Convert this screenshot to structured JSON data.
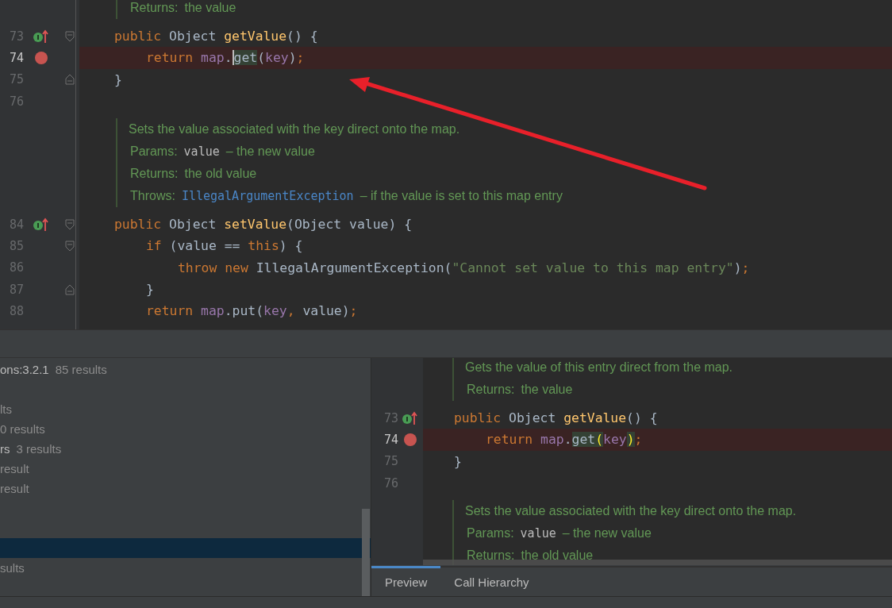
{
  "editor": {
    "rows": [
      {
        "kind": "doc",
        "lines": [
          [
            {
              "kind": "tag",
              "t": "Returns:"
            },
            {
              "kind": "text",
              "t": "the value"
            }
          ]
        ]
      },
      {
        "kind": "code",
        "number": "73",
        "override": true,
        "breakpoint": false,
        "fold_start": true,
        "fold_end": false,
        "current": false,
        "highlight": false,
        "tokens": [
          {
            "kind": "kw",
            "t": "public "
          },
          {
            "kind": "type",
            "t": "Object "
          },
          {
            "kind": "method",
            "t": "getValue"
          },
          {
            "kind": "punct",
            "t": "() {"
          }
        ],
        "children": [
          {
            "kind": "code",
            "number": "74",
            "override": false,
            "breakpoint": true,
            "fold_start": false,
            "fold_end": false,
            "current": true,
            "highlight": true,
            "tokens": [
              {
                "kind": "kw",
                "t": "return "
              },
              {
                "kind": "field",
                "t": "map"
              },
              {
                "kind": "punct",
                "t": "."
              },
              {
                "kind": "plain",
                "t": "get",
                "usage": true,
                "caret": true
              },
              {
                "kind": "punct",
                "t": "("
              },
              {
                "kind": "field",
                "t": "key"
              },
              {
                "kind": "punct",
                "t": ")"
              },
              {
                "kind": "semi",
                "t": ";"
              }
            ]
          }
        ]
      },
      {
        "kind": "code",
        "number": "75",
        "override": false,
        "breakpoint": false,
        "fold_start": false,
        "fold_end": true,
        "current": false,
        "highlight": false,
        "tokens": [
          {
            "kind": "punct",
            "t": "}"
          }
        ]
      },
      {
        "kind": "code",
        "number": "76",
        "override": false,
        "breakpoint": false,
        "fold_start": false,
        "fold_end": false,
        "current": false,
        "highlight": false,
        "tokens": []
      },
      {
        "kind": "doc",
        "lines": [
          [
            {
              "kind": "text",
              "t": "Sets the value associated with the key direct onto the map."
            }
          ],
          [
            {
              "kind": "tag",
              "t": "Params:"
            },
            {
              "kind": "code",
              "t": "value"
            },
            {
              "kind": "text",
              "t": "– the new value"
            }
          ],
          [
            {
              "kind": "tag",
              "t": "Returns:"
            },
            {
              "kind": "text",
              "t": "the old value"
            }
          ],
          [
            {
              "kind": "tag",
              "t": "Throws:"
            },
            {
              "kind": "link",
              "t": "IllegalArgumentException"
            },
            {
              "kind": "text",
              "t": "– if the value is set to this map entry"
            }
          ]
        ]
      },
      {
        "kind": "code",
        "number": "84",
        "override": true,
        "breakpoint": false,
        "fold_start": true,
        "fold_end": false,
        "current": false,
        "highlight": false,
        "tokens": [
          {
            "kind": "kw",
            "t": "public "
          },
          {
            "kind": "type",
            "t": "Object "
          },
          {
            "kind": "method",
            "t": "setValue"
          },
          {
            "kind": "punct",
            "t": "("
          },
          {
            "kind": "type",
            "t": "Object "
          },
          {
            "kind": "plain",
            "t": "value"
          },
          {
            "kind": "punct",
            "t": ") {"
          }
        ],
        "children": [
          {
            "kind": "code",
            "number": "85",
            "override": false,
            "breakpoint": false,
            "fold_start": true,
            "fold_end": false,
            "current": false,
            "highlight": false,
            "tokens": [
              {
                "kind": "kw",
                "t": "if "
              },
              {
                "kind": "punct",
                "t": "("
              },
              {
                "kind": "plain",
                "t": "value == "
              },
              {
                "kind": "kw",
                "t": "this"
              },
              {
                "kind": "punct",
                "t": ") {"
              }
            ],
            "children": [
              {
                "kind": "code",
                "number": "86",
                "override": false,
                "breakpoint": false,
                "fold_start": false,
                "fold_end": false,
                "current": false,
                "highlight": false,
                "tokens": [
                  {
                    "kind": "kw",
                    "t": "throw new "
                  },
                  {
                    "kind": "type",
                    "t": "IllegalArgumentException"
                  },
                  {
                    "kind": "punct",
                    "t": "("
                  },
                  {
                    "kind": "str",
                    "t": "\"Cannot set value to this map entry\""
                  },
                  {
                    "kind": "punct",
                    "t": ")"
                  },
                  {
                    "kind": "semi",
                    "t": ";"
                  }
                ]
              }
            ]
          },
          {
            "kind": "code",
            "number": "87",
            "override": false,
            "breakpoint": false,
            "fold_start": false,
            "fold_end": true,
            "current": false,
            "highlight": false,
            "tokens": [
              {
                "kind": "punct",
                "t": "}"
              }
            ]
          },
          {
            "kind": "code",
            "number": "88",
            "override": false,
            "breakpoint": false,
            "fold_start": false,
            "fold_end": false,
            "current": false,
            "highlight": false,
            "tokens": [
              {
                "kind": "kw",
                "t": "return "
              },
              {
                "kind": "field",
                "t": "map"
              },
              {
                "kind": "punct",
                "t": ".put("
              },
              {
                "kind": "field",
                "t": "key"
              },
              {
                "kind": "semi",
                "t": ", "
              },
              {
                "kind": "plain",
                "t": "value"
              },
              {
                "kind": "punct",
                "t": ")"
              },
              {
                "kind": "semi",
                "t": ";"
              }
            ]
          }
        ]
      }
    ]
  },
  "usages": {
    "rows": [
      {
        "name": "ons:3.2.1",
        "count": "85 results",
        "selected": false
      },
      {
        "selected": false
      },
      {
        "count": "lts",
        "selected": false
      },
      {
        "count": "0 results",
        "selected": false
      },
      {
        "name": "rs",
        "count": "3 results",
        "selected": false
      },
      {
        "count": "result",
        "selected": false
      },
      {
        "count": "result",
        "selected": false
      },
      {
        "selected": false
      },
      {
        "selected": false
      },
      {
        "selected": true
      },
      {
        "count": "sults",
        "selected": false
      }
    ]
  },
  "preview": {
    "rows": [
      {
        "kind": "doc",
        "lines": [
          [
            {
              "kind": "text",
              "t": "Gets the value of this entry direct from the map."
            }
          ],
          [
            {
              "kind": "tag",
              "t": "Returns:"
            },
            {
              "kind": "text",
              "t": "the value"
            }
          ]
        ]
      },
      {
        "kind": "code",
        "number": "73",
        "override": true,
        "breakpoint": false,
        "current": false,
        "highlight": false,
        "tokens": [
          {
            "kind": "kw",
            "t": "public "
          },
          {
            "kind": "type",
            "t": "Object "
          },
          {
            "kind": "method",
            "t": "getValue"
          },
          {
            "kind": "punct",
            "t": "() {"
          }
        ],
        "children": [
          {
            "kind": "code",
            "number": "74",
            "override": false,
            "breakpoint": true,
            "current": true,
            "highlight": true,
            "tokens": [
              {
                "kind": "kw",
                "t": "return "
              },
              {
                "kind": "field",
                "t": "map"
              },
              {
                "kind": "punct",
                "t": "."
              },
              {
                "kind": "plain",
                "t": "get",
                "usage": true
              },
              {
                "kind": "brace",
                "t": "(",
                "usage": true
              },
              {
                "kind": "field",
                "t": "key"
              },
              {
                "kind": "brace",
                "t": ")",
                "usage": true
              },
              {
                "kind": "semi",
                "t": ";"
              }
            ]
          }
        ]
      },
      {
        "kind": "code",
        "number": "75",
        "override": false,
        "breakpoint": false,
        "current": false,
        "highlight": false,
        "tokens": [
          {
            "kind": "punct",
            "t": "}"
          }
        ]
      },
      {
        "kind": "code",
        "number": "76",
        "override": false,
        "breakpoint": false,
        "current": false,
        "highlight": false,
        "tokens": []
      },
      {
        "kind": "doc",
        "lines": [
          [
            {
              "kind": "text",
              "t": "Sets the value associated with the key direct onto the map."
            }
          ],
          [
            {
              "kind": "tag",
              "t": "Params:"
            },
            {
              "kind": "code",
              "t": "value"
            },
            {
              "kind": "text",
              "t": "– the new value"
            }
          ],
          [
            {
              "kind": "tag",
              "t": "Returns:"
            },
            {
              "kind": "text",
              "t": "the old value"
            }
          ]
        ]
      }
    ],
    "tabs": [
      {
        "label": "Preview",
        "selected": true
      },
      {
        "label": "Call Hierarchy",
        "selected": false
      }
    ]
  }
}
